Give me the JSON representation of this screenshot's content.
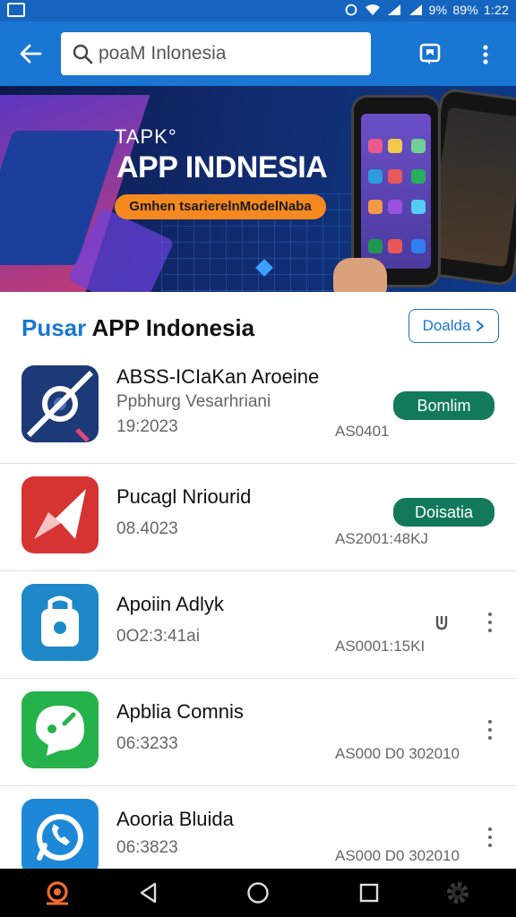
{
  "status_bar": {
    "battery_left": "9%",
    "battery_right": "89%",
    "time": "1:22"
  },
  "search": {
    "value": "poaM Inlonesia",
    "placeholder": "poaM Inlonesia"
  },
  "banner": {
    "brand": "TAPK°",
    "headline": "APP INDNESIA",
    "tagline": "Gmhen tsarierelnModelNaba"
  },
  "section": {
    "title_accent": "Pusar",
    "title_rest": "APP Indonesia",
    "see_all_label": "Doalda"
  },
  "apps": [
    {
      "name": "ABSS-ICIaKan Aroeine",
      "developer": "Ppbhurg Vesarhriani",
      "date": "19:2023",
      "code": "AS0401",
      "action_label": "Bomlim",
      "icon": "target-icon",
      "icon_color": "#1e3a78"
    },
    {
      "name": "Pucagl Nriourid",
      "developer": "",
      "date": "08.4023",
      "code": "AS2001:48KJ",
      "action_label": "Doisatia",
      "icon": "plane-icon",
      "icon_color": "#d63333"
    },
    {
      "name": "Apoiin Adlyk",
      "developer": "",
      "date": "0O2:3:41ai",
      "code": "AS0001:15KI",
      "action_label": "",
      "icon": "lock-icon",
      "icon_color": "#1e88c8"
    },
    {
      "name": "Apblia Comnis",
      "developer": "",
      "date": "06:3233",
      "code": "AS000 D0 302010",
      "action_label": "",
      "icon": "chat-bubble-icon",
      "icon_color": "#26b24a"
    },
    {
      "name": "Aooria Bluida",
      "developer": "",
      "date": "06:3823",
      "code": "AS000 D0 302010",
      "action_label": "",
      "icon": "phone-call-icon",
      "icon_color": "#1e88d8"
    }
  ],
  "colors": {
    "app_bar": "#1976d2",
    "accent": "#1976d2",
    "action_button": "#127a5a",
    "banner_pill": "#f5891f"
  }
}
